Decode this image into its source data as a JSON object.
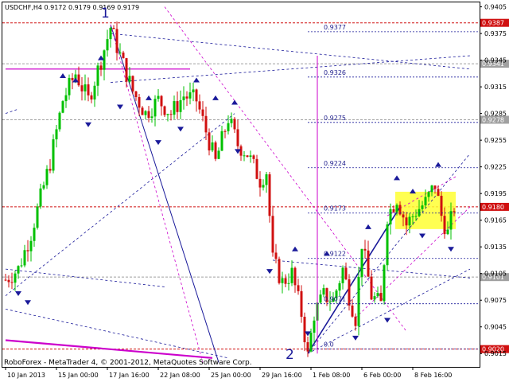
{
  "chart_data": {
    "type": "candlestick",
    "header": "USDCHF,H4  0.9172 0.9179 0.9169 0.9179",
    "footer": "RoboForex - MetaTrader 4, © 2001-2012, MetaQuotes Software Corp.",
    "ylim": [
      0.9,
      0.941
    ],
    "y_ticks": [
      "0.9405",
      "0.9375",
      "0.9345",
      "0.9315",
      "0.9285",
      "0.9255",
      "0.9225",
      "0.9195",
      "0.9165",
      "0.9135",
      "0.9105",
      "0.9075",
      "0.9045",
      "0.9015"
    ],
    "x_ticks": [
      {
        "i": 0,
        "label": "10 Jan 2013"
      },
      {
        "i": 16,
        "label": "15 Jan 00:00"
      },
      {
        "i": 32,
        "label": "17 Jan 16:00"
      },
      {
        "i": 48,
        "label": "22 Jan 08:00"
      },
      {
        "i": 64,
        "label": "25 Jan 00:00"
      },
      {
        "i": 80,
        "label": "29 Jan 16:00"
      },
      {
        "i": 96,
        "label": "1 Feb 08:00"
      },
      {
        "i": 112,
        "label": "6 Feb 00:00"
      },
      {
        "i": 128,
        "label": "8 Feb 16:00"
      }
    ],
    "x_slots": 146,
    "close_path": [
      [
        0,
        0.9098
      ],
      [
        4,
        0.911
      ],
      [
        8,
        0.915
      ],
      [
        14,
        0.923
      ],
      [
        18,
        0.93
      ],
      [
        22,
        0.933
      ],
      [
        26,
        0.93
      ],
      [
        30,
        0.9345
      ],
      [
        33,
        0.9382
      ],
      [
        36,
        0.935
      ],
      [
        40,
        0.931
      ],
      [
        44,
        0.9285
      ],
      [
        48,
        0.93
      ],
      [
        52,
        0.9285
      ],
      [
        56,
        0.9305
      ],
      [
        60,
        0.93
      ],
      [
        63,
        0.9265
      ],
      [
        66,
        0.923
      ],
      [
        70,
        0.928
      ],
      [
        73,
        0.925
      ],
      [
        76,
        0.924
      ],
      [
        80,
        0.921
      ],
      [
        82,
        0.922
      ],
      [
        84,
        0.912
      ],
      [
        87,
        0.9095
      ],
      [
        90,
        0.9105
      ],
      [
        93,
        0.906
      ],
      [
        95,
        0.9012
      ],
      [
        97,
        0.906
      ],
      [
        100,
        0.908
      ],
      [
        103,
        0.9075
      ],
      [
        106,
        0.911
      ],
      [
        108,
        0.908
      ],
      [
        110,
        0.9055
      ],
      [
        112,
        0.914
      ],
      [
        115,
        0.908
      ],
      [
        118,
        0.907
      ],
      [
        120,
        0.917
      ],
      [
        123,
        0.919
      ],
      [
        126,
        0.916
      ],
      [
        129,
        0.9175
      ],
      [
        132,
        0.9185
      ],
      [
        135,
        0.9205
      ],
      [
        137,
        0.917
      ],
      [
        139,
        0.915
      ],
      [
        141,
        0.918
      ]
    ],
    "seed": 7,
    "price_lines": [
      {
        "value": 0.9387,
        "label": "0.9387",
        "color": "#d01010"
      },
      {
        "value": 0.9341,
        "label": "0.9341",
        "color": "#a0a0a0"
      },
      {
        "value": 0.9278,
        "label": "0.9278",
        "color": "#a0a0a0"
      },
      {
        "value": 0.918,
        "label": "0.9180",
        "color": "#d01010"
      },
      {
        "value": 0.9101,
        "label": "0.9101",
        "color": "#a0a0a0"
      },
      {
        "value": 0.902,
        "label": "0.9020",
        "color": "#d01010"
      }
    ],
    "fib_levels": [
      {
        "value": 0.9377,
        "label": "0.9377"
      },
      {
        "value": 0.9326,
        "label": "0.9326"
      },
      {
        "value": 0.9275,
        "label": "0.9275"
      },
      {
        "value": 0.9224,
        "label": "0.9224"
      },
      {
        "value": 0.9173,
        "label": "0.9173"
      },
      {
        "value": 0.9122,
        "label": "0.9122"
      },
      {
        "value": 0.9071,
        "label": "0.9071"
      },
      {
        "value": 0.902,
        "label": "0.0"
      }
    ],
    "wave_labels": [
      {
        "i": 32,
        "value": 0.94,
        "text": "1"
      },
      {
        "i": 90,
        "value": 0.9016,
        "text": "2"
      }
    ],
    "colors": {
      "up": "#00c000",
      "down": "#d01010",
      "hline_red": "#d01010",
      "magenta": "#cc00cc",
      "navy": "#1a1a9a",
      "yellow": "#ffff33"
    }
  }
}
